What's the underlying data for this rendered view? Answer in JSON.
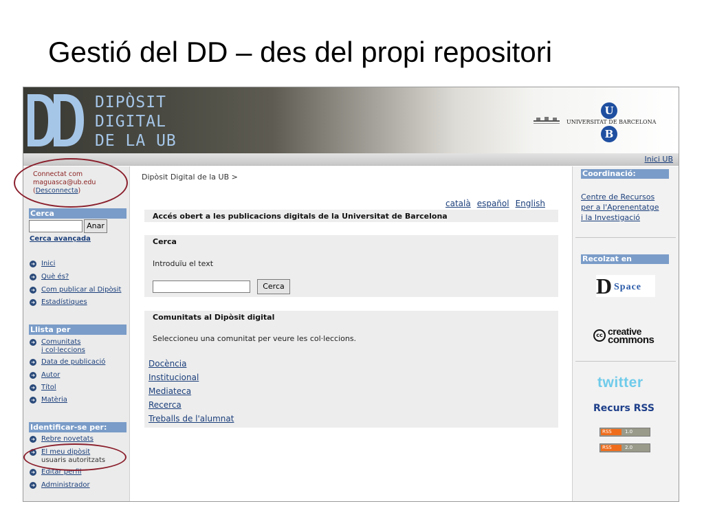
{
  "slide": {
    "title": "Gestió del DD – des del propi repositori"
  },
  "banner": {
    "logo_lines": [
      "DIPÒSIT",
      "DIGITAL",
      "DE LA UB"
    ],
    "ub_letters": [
      "U",
      "B"
    ],
    "university_name": "UNIVERSITAT DE BARCELONA",
    "logo_color": "#a6c6e8"
  },
  "topnav": {
    "inici_ub": "Inici UB"
  },
  "user": {
    "connected_label": "Connectat com",
    "email": "maguasca@ub.edu",
    "logout_open": "(",
    "logout_label": "Desconnecta",
    "logout_close": ")"
  },
  "sidebar": {
    "search_head": "Cerca",
    "search_button": "Anar",
    "advanced_search": "Cerca avançada",
    "nav_items": [
      "Inici",
      "Què és?",
      "Com publicar al Dipòsit",
      "Estadístiques"
    ],
    "browse_head": "Llista per",
    "browse_items": [
      {
        "line1": "Comunitats",
        "line2": "i col·leccions"
      },
      {
        "line1": "Data de publicació"
      },
      {
        "line1": "Autor"
      },
      {
        "line1": "Títol"
      },
      {
        "line1": "Matèria"
      }
    ],
    "identify_head": "Identificar-se per:",
    "identify_items": [
      {
        "line1": "Rebre novetats"
      },
      {
        "line1": "El meu dipòsit",
        "line2": "usuaris autoritzats"
      },
      {
        "line1": "Editar perfil"
      },
      {
        "line1": "Administrador"
      }
    ]
  },
  "main": {
    "breadcrumb": "Dipòsit Digital de la UB  >",
    "languages": [
      "català",
      "español",
      "English"
    ],
    "intro_heading": "Accés obert a les publicacions digitals de la Universitat de Barcelona",
    "search_panel": {
      "heading": "Cerca",
      "prompt": "Introduïu el text",
      "button": "Cerca"
    },
    "communities_panel": {
      "heading": "Comunitats al Dipòsit digital",
      "prompt": "Seleccioneu una comunitat per veure les col·leccions.",
      "items": [
        "Docència",
        "Institucional",
        "Mediateca",
        "Recerca",
        "Treballs de l'alumnat"
      ]
    }
  },
  "rightbar": {
    "coordination_head": "Coordinació:",
    "coordination_link_lines": [
      "Centre de Recursos",
      "per a l'Aprenentatge",
      "i la Investigació"
    ],
    "supported_head": "Recolzat en",
    "dspace_letter": "D",
    "dspace_rest": "Space",
    "cc_symbol": "cc",
    "cc_word1": "creative",
    "cc_word2": "commons",
    "twitter": "twitter",
    "rss_title": "Recurs RSS",
    "rss_badges": [
      {
        "left": "RSS",
        "right": "1.0"
      },
      {
        "left": "RSS",
        "right": "2.0"
      }
    ]
  }
}
